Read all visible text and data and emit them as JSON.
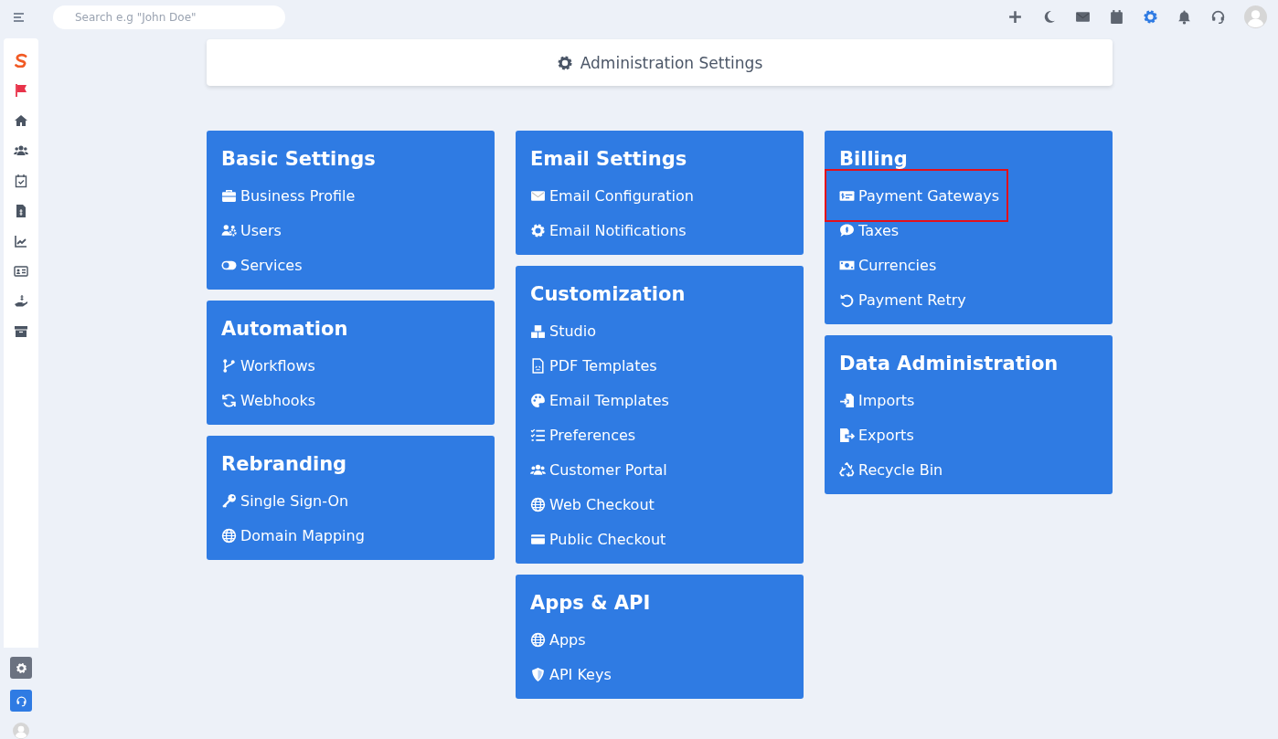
{
  "topbar": {
    "search": {
      "placeholder": "Search e.g \"John Doe\""
    },
    "actions": [
      {
        "selected": false
      },
      {
        "selected": false
      },
      {
        "selected": false
      },
      {
        "selected": false
      },
      {
        "selected": true
      },
      {
        "selected": false
      },
      {
        "selected": false
      }
    ]
  },
  "sidebar": {
    "bottom": [
      {
        "selected": false
      },
      {
        "selected": true
      }
    ]
  },
  "header": {
    "title": "Administration Settings"
  },
  "columns": [
    [
      {
        "title": "Basic Settings",
        "items": [
          {
            "label": "Business Profile",
            "highlighted": false
          },
          {
            "label": "Users",
            "highlighted": false
          },
          {
            "label": "Services",
            "highlighted": false
          }
        ]
      },
      {
        "title": "Automation",
        "items": [
          {
            "label": "Workflows",
            "highlighted": false
          },
          {
            "label": "Webhooks",
            "highlighted": false
          }
        ]
      },
      {
        "title": "Rebranding",
        "items": [
          {
            "label": "Single Sign-On",
            "highlighted": false
          },
          {
            "label": "Domain Mapping",
            "highlighted": false
          }
        ]
      }
    ],
    [
      {
        "title": "Email Settings",
        "items": [
          {
            "label": "Email Configuration",
            "highlighted": false
          },
          {
            "label": "Email Notifications",
            "highlighted": false
          }
        ]
      },
      {
        "title": "Customization",
        "items": [
          {
            "label": "Studio",
            "highlighted": false
          },
          {
            "label": "PDF Templates",
            "highlighted": false
          },
          {
            "label": "Email Templates",
            "highlighted": false
          },
          {
            "label": "Preferences",
            "highlighted": false
          },
          {
            "label": "Customer Portal",
            "highlighted": false
          },
          {
            "label": "Web Checkout",
            "highlighted": false
          },
          {
            "label": "Public Checkout",
            "highlighted": false
          }
        ]
      },
      {
        "title": "Apps & API",
        "items": [
          {
            "label": "Apps",
            "highlighted": false
          },
          {
            "label": "API Keys",
            "highlighted": false
          }
        ]
      }
    ],
    [
      {
        "title": "Billing",
        "items": [
          {
            "label": "Payment Gateways",
            "highlighted": true
          },
          {
            "label": "Taxes",
            "highlighted": false
          },
          {
            "label": "Currencies",
            "highlighted": false
          },
          {
            "label": "Payment Retry",
            "highlighted": false
          }
        ]
      },
      {
        "title": "Data Administration",
        "items": [
          {
            "label": "Imports",
            "highlighted": false
          },
          {
            "label": "Exports",
            "highlighted": false
          },
          {
            "label": "Recycle Bin",
            "highlighted": false
          }
        ]
      }
    ]
  ]
}
